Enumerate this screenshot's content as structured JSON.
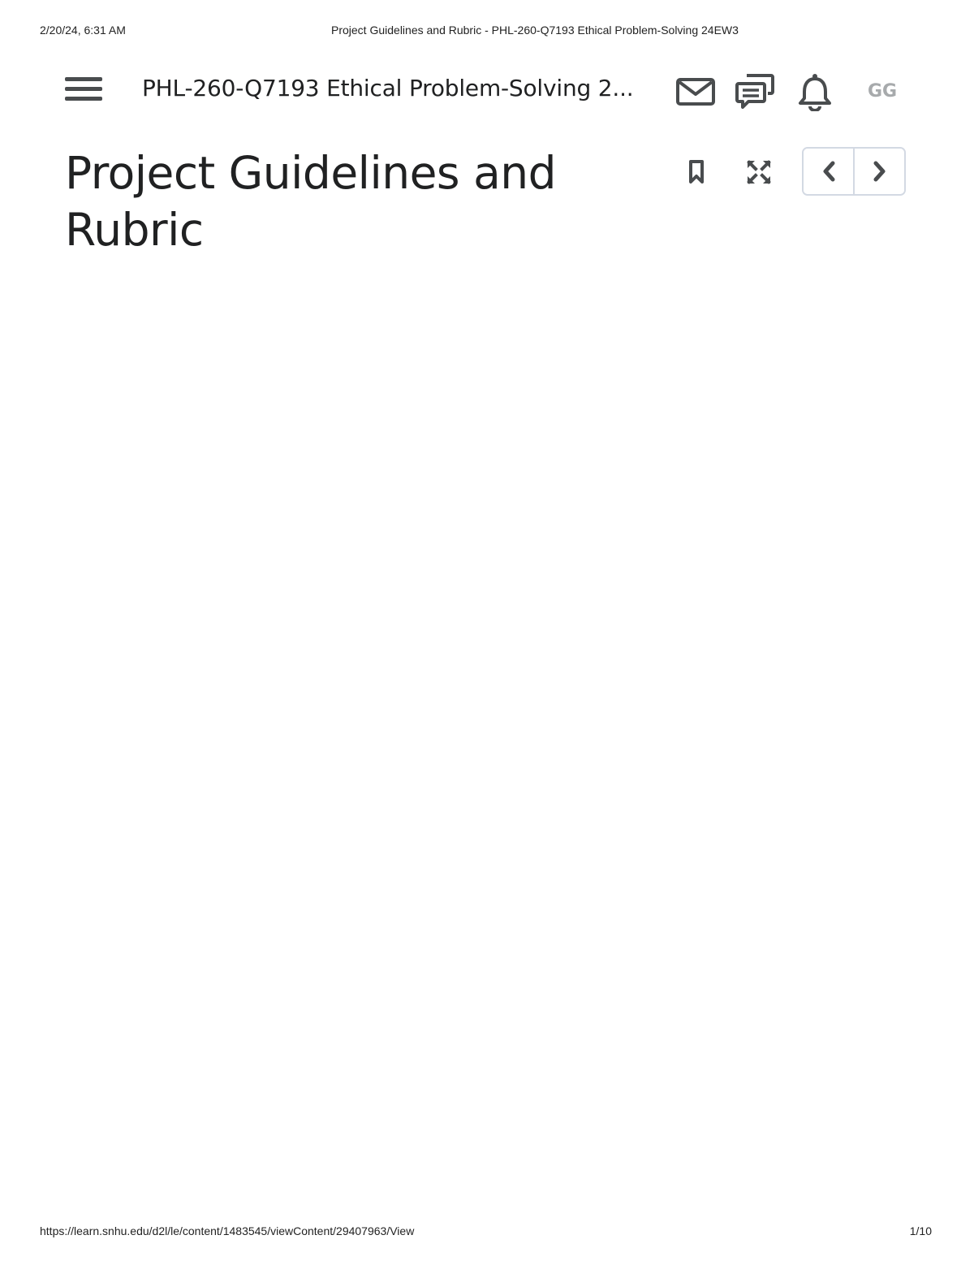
{
  "print_header": {
    "date": "2/20/24, 6:31 AM",
    "title": "Project Guidelines and Rubric - PHL-260-Q7193 Ethical Problem-Solving 24EW3"
  },
  "navbar": {
    "course_title": "PHL-260-Q7193 Ethical Problem-Solving 2...",
    "icons": [
      "menu-icon",
      "mail-icon",
      "chat-icon",
      "bell-icon"
    ],
    "avatar_initials": "GG"
  },
  "content": {
    "page_title_line1": "Project Guidelines and",
    "page_title_line2": "Rubric",
    "tools": [
      "bookmark-icon",
      "fullscreen-icon"
    ],
    "pager": [
      "chevron-left-icon",
      "chevron-right-icon"
    ]
  },
  "print_footer": {
    "url": "https://learn.snhu.edu/d2l/le/content/1483545/viewContent/29407963/View",
    "page": "1/10"
  },
  "colors": {
    "icon": "#494c4e",
    "text": "#202122",
    "avatar": "#a7aaac",
    "border": "#d3d9e3"
  }
}
